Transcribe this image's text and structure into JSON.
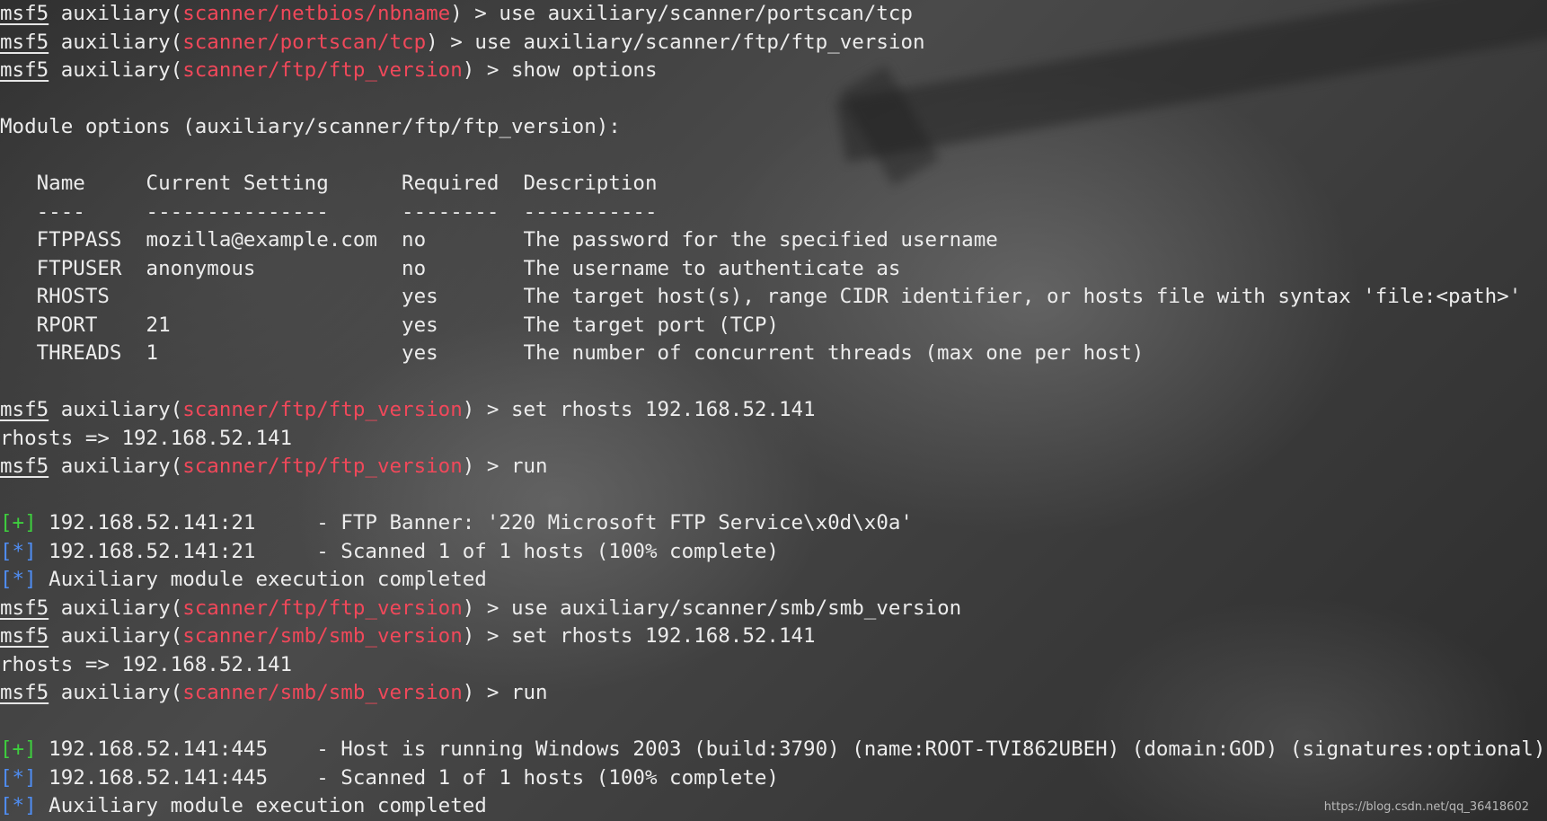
{
  "colors": {
    "module": "#f0485a",
    "success": "#3ecf3e",
    "info": "#4f8df2",
    "text": "#ececec"
  },
  "lines": [
    {
      "type": "prompt",
      "prefix": "msf5",
      "ctx": " auxiliary(",
      "module": "scanner/netbios/nbname",
      "suffix": ") > use auxiliary/scanner/portscan/tcp"
    },
    {
      "type": "prompt",
      "prefix": "msf5",
      "ctx": " auxiliary(",
      "module": "scanner/portscan/tcp",
      "suffix": ") > use auxiliary/scanner/ftp/ftp_version"
    },
    {
      "type": "prompt",
      "prefix": "msf5",
      "ctx": " auxiliary(",
      "module": "scanner/ftp/ftp_version",
      "suffix": ") > show options"
    },
    {
      "type": "blank"
    },
    {
      "type": "text",
      "text": "Module options (auxiliary/scanner/ftp/ftp_version):"
    },
    {
      "type": "blank"
    },
    {
      "type": "text",
      "text": "   Name     Current Setting      Required  Description"
    },
    {
      "type": "text",
      "text": "   ----     ---------------      --------  -----------"
    },
    {
      "type": "text",
      "text": "   FTPPASS  mozilla@example.com  no        The password for the specified username"
    },
    {
      "type": "text",
      "text": "   FTPUSER  anonymous            no        The username to authenticate as"
    },
    {
      "type": "text",
      "text": "   RHOSTS                        yes       The target host(s), range CIDR identifier, or hosts file with syntax 'file:<path>'"
    },
    {
      "type": "text",
      "text": "   RPORT    21                   yes       The target port (TCP)"
    },
    {
      "type": "text",
      "text": "   THREADS  1                    yes       The number of concurrent threads (max one per host)"
    },
    {
      "type": "blank"
    },
    {
      "type": "prompt",
      "prefix": "msf5",
      "ctx": " auxiliary(",
      "module": "scanner/ftp/ftp_version",
      "suffix": ") > set rhosts 192.168.52.141"
    },
    {
      "type": "text",
      "text": "rhosts => 192.168.52.141"
    },
    {
      "type": "prompt",
      "prefix": "msf5",
      "ctx": " auxiliary(",
      "module": "scanner/ftp/ftp_version",
      "suffix": ") > run"
    },
    {
      "type": "blank"
    },
    {
      "type": "status",
      "marker": "[+]",
      "kind": "ok",
      "text": " 192.168.52.141:21     - FTP Banner: '220 Microsoft FTP Service\\x0d\\x0a'"
    },
    {
      "type": "status",
      "marker": "[*]",
      "kind": "info",
      "text": " 192.168.52.141:21     - Scanned 1 of 1 hosts (100% complete)"
    },
    {
      "type": "status",
      "marker": "[*]",
      "kind": "info",
      "text": " Auxiliary module execution completed"
    },
    {
      "type": "prompt",
      "prefix": "msf5",
      "ctx": " auxiliary(",
      "module": "scanner/ftp/ftp_version",
      "suffix": ") > use auxiliary/scanner/smb/smb_version"
    },
    {
      "type": "prompt",
      "prefix": "msf5",
      "ctx": " auxiliary(",
      "module": "scanner/smb/smb_version",
      "suffix": ") > set rhosts 192.168.52.141"
    },
    {
      "type": "text",
      "text": "rhosts => 192.168.52.141"
    },
    {
      "type": "prompt",
      "prefix": "msf5",
      "ctx": " auxiliary(",
      "module": "scanner/smb/smb_version",
      "suffix": ") > run"
    },
    {
      "type": "blank"
    },
    {
      "type": "status",
      "marker": "[+]",
      "kind": "ok",
      "text": " 192.168.52.141:445    - Host is running Windows 2003 (build:3790) (name:ROOT-TVI862UBEH) (domain:GOD) (signatures:optional)"
    },
    {
      "type": "status",
      "marker": "[*]",
      "kind": "info",
      "text": " 192.168.52.141:445    - Scanned 1 of 1 hosts (100% complete)"
    },
    {
      "type": "status",
      "marker": "[*]",
      "kind": "info",
      "text": " Auxiliary module execution completed"
    }
  ],
  "watermark": "https://blog.csdn.net/qq_36418602"
}
